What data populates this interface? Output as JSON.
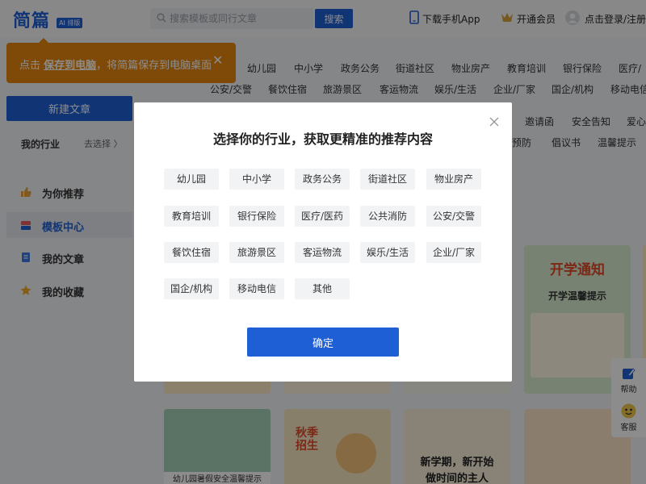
{
  "header": {
    "logo_text": "简篇",
    "logo_badge": "AI 排版",
    "search_placeholder": "搜索模板或同行文章",
    "search_button": "搜索",
    "download_app": "下载手机App",
    "vip": "开通会员",
    "login": "点击登录/注册"
  },
  "tip": {
    "prefix": "点击 ",
    "link": "保存到电脑",
    "suffix": "，将简篇保存到电脑桌面"
  },
  "sidebar": {
    "new_article": "新建文章",
    "my_industry": "我的行业",
    "go_select": "去选择 〉",
    "items": [
      {
        "label": "为你推荐"
      },
      {
        "label": "模板中心"
      },
      {
        "label": "我的文章"
      },
      {
        "label": "我的收藏"
      }
    ]
  },
  "background_categories": {
    "row1": [
      "幼儿园",
      "中小学",
      "政务公务",
      "街道社区",
      "物业房产",
      "教育培训",
      "银行保险",
      "医疗/"
    ],
    "row2": [
      "公安/交警",
      "餐饮住宿",
      "旅游景区",
      "客运物流",
      "娱乐/生活",
      "企业/厂家",
      "国企/机构",
      "移动电信"
    ],
    "row3": [
      "邀请函",
      "安全告知",
      "爱心"
    ],
    "row4": [
      "预防",
      "倡议书",
      "温馨提示"
    ]
  },
  "thumbnails": {
    "card_top_right_title": "开学通知",
    "card_top_right_sub": "开学温馨提示",
    "card_bottom1_caption": "幼儿园暑假安全温馨提示",
    "card_bottom2_title": "秋季招生",
    "card_bottom3_title_l1": "新学期，新开始",
    "card_bottom3_title_l2": "做时间的主人"
  },
  "modal": {
    "title": "选择你的行业，获取更精准的推荐内容",
    "options": [
      "幼儿园",
      "中小学",
      "政务公务",
      "街道社区",
      "物业房产",
      "教育培训",
      "银行保险",
      "医疗/医药",
      "公共消防",
      "公安/交警",
      "餐饮住宿",
      "旅游景区",
      "客运物流",
      "娱乐/生活",
      "企业/厂家",
      "国企/机构",
      "移动电信",
      "其他"
    ],
    "confirm": "确定"
  },
  "float_panel": {
    "help": "帮助",
    "service": "客服"
  },
  "colors": {
    "brand": "#1f5fd6",
    "tip": "#e8870f"
  }
}
